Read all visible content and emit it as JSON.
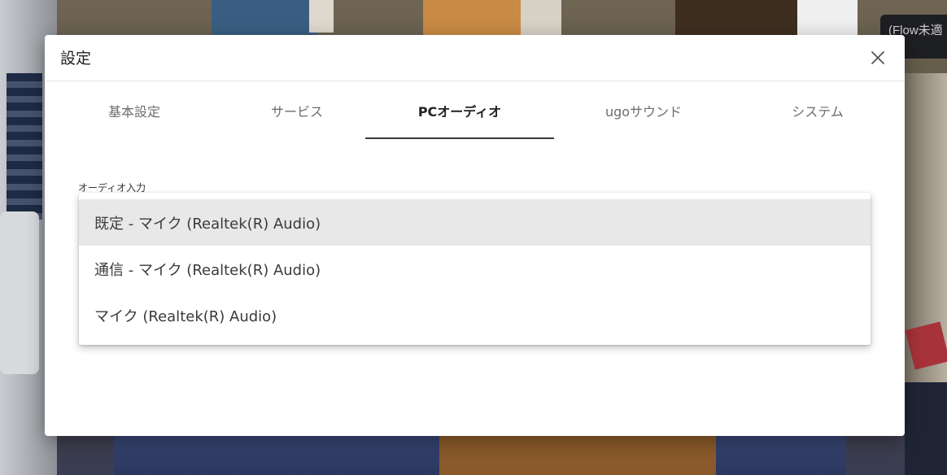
{
  "background": {
    "flow_tag": "(Flow未適"
  },
  "dialog": {
    "title": "設定",
    "tabs": [
      {
        "label": "基本設定",
        "active": false
      },
      {
        "label": "サービス",
        "active": false
      },
      {
        "label": "PCオーディオ",
        "active": true
      },
      {
        "label": "ugoサウンド",
        "active": false
      },
      {
        "label": "システム",
        "active": false
      }
    ],
    "audio_input": {
      "label": "オーディオ入力",
      "options": [
        {
          "label": "既定 - マイク (Realtek(R) Audio)",
          "selected": true
        },
        {
          "label": "通信 - マイク (Realtek(R) Audio)",
          "selected": false
        },
        {
          "label": "マイク (Realtek(R) Audio)",
          "selected": false
        }
      ]
    }
  },
  "icons": {
    "close": "close-icon"
  },
  "colors": {
    "dialog_bg": "#ffffff",
    "tab_active": "#222222",
    "tab_inactive": "#6c6c6c",
    "indicator": "#3a3a3a",
    "selected_option_bg": "#e7e8e7"
  }
}
